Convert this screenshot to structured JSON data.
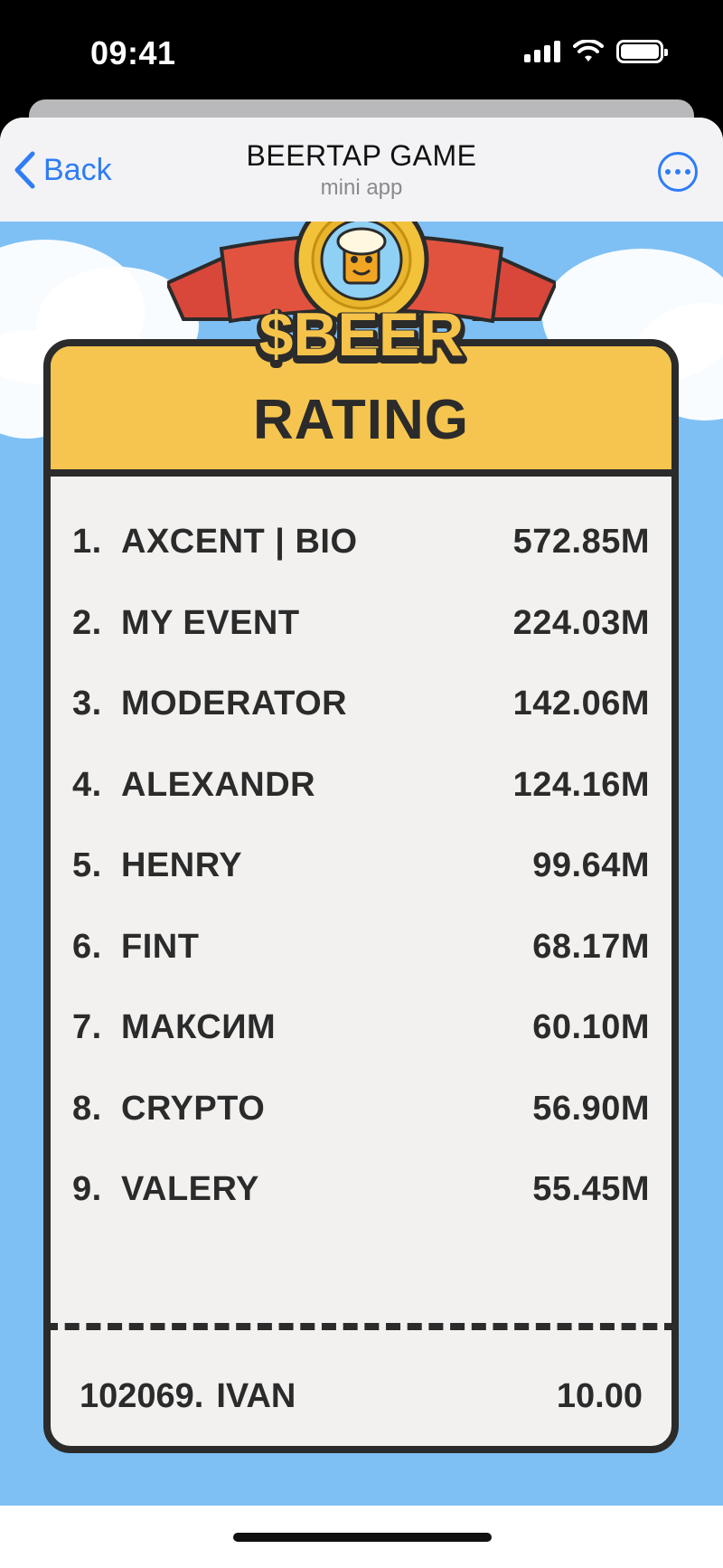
{
  "status_bar": {
    "time": "09:41"
  },
  "nav": {
    "back_label": "Back",
    "title": "BEERTAP GAME",
    "subtitle": "mini app"
  },
  "logo": {
    "text": "$BEER",
    "ring_text": "$BEER"
  },
  "panel": {
    "title": "RATING"
  },
  "leaderboard": [
    {
      "rank": "1.",
      "name": "AXCENT | BIO",
      "score": "572.85M"
    },
    {
      "rank": "2.",
      "name": "MY EVENT",
      "score": "224.03M"
    },
    {
      "rank": "3.",
      "name": "MODERATOR",
      "score": "142.06M"
    },
    {
      "rank": "4.",
      "name": "ALEXANDR",
      "score": "124.16M"
    },
    {
      "rank": "5.",
      "name": "HENRY",
      "score": "99.64M"
    },
    {
      "rank": "6.",
      "name": "FINT",
      "score": "68.17M"
    },
    {
      "rank": "7.",
      "name": "МАКСИМ",
      "score": "60.10M"
    },
    {
      "rank": "8.",
      "name": "CRYPTO",
      "score": "56.90M"
    },
    {
      "rank": "9.",
      "name": "VALERY",
      "score": "55.45M"
    }
  ],
  "current_user": {
    "rank": "102069.",
    "name": "IVAN",
    "score": "10.00"
  },
  "colors": {
    "accent": "#2f7cf6",
    "sky": "#7ec0f4",
    "header_yellow": "#f5c54f",
    "ribbon": "#d9473a",
    "ink": "#2b2b2b"
  }
}
